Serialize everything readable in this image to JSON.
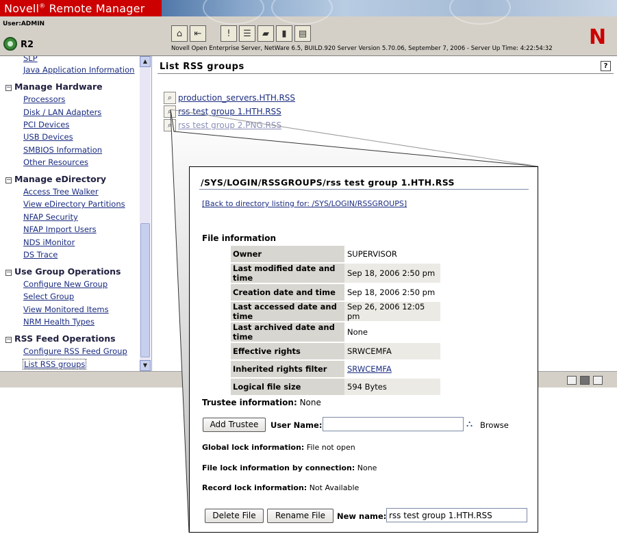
{
  "app": {
    "brand": "Novell",
    "brand_suffix": "Remote Manager",
    "user_label": "User:",
    "user_name": "ADMIN",
    "server_name": "R2",
    "server_info": "Novell Open Enterprise Server, NetWare 6.5, BUILD.920  Server Version 5.70.06, September 7, 2006 - Server Up Time: 4:22:54:32",
    "logo_letter": "N",
    "toolbar_icons": [
      "home-icon",
      "exit-icon",
      "health-alert-icon",
      "checklist-icon",
      "eraser-icon",
      "book-icon",
      "inbox-icon"
    ]
  },
  "sidebar": {
    "top_items": [
      "SLP",
      "Java Application Information"
    ],
    "groups": [
      {
        "title": "Manage Hardware",
        "items": [
          "Processors",
          "Disk / LAN Adapters",
          "PCI Devices",
          "USB Devices",
          "SMBIOS Information",
          "Other Resources"
        ]
      },
      {
        "title": "Manage eDirectory",
        "items": [
          "Access Tree Walker",
          "View eDirectory Partitions",
          "NFAP Security",
          "NFAP Import Users",
          "NDS iMonitor",
          "DS Trace"
        ]
      },
      {
        "title": "Use Group Operations",
        "items": [
          "Configure New Group",
          "Select Group",
          "View Monitored Items",
          "NRM Health Types"
        ]
      },
      {
        "title": "RSS Feed Operations",
        "items": [
          "Configure RSS Feed Group",
          "List RSS groups"
        ]
      }
    ],
    "selected": "List RSS groups"
  },
  "main": {
    "title": "List RSS groups",
    "help": "?",
    "rss_groups": [
      "production_servers.HTH.RSS",
      "rss test group 1.HTH.RSS",
      "rss test group 2.PNG.RSS"
    ]
  },
  "detail": {
    "path": "/SYS/LOGIN/RSSGROUPS/rss test group 1.HTH.RSS",
    "back_link": "[Back to directory listing for: /SYS/LOGIN/RSSGROUPS]",
    "file_info_title": "File information",
    "file_info": [
      {
        "label": "Owner",
        "value": "SUPERVISOR"
      },
      {
        "label": "Last modified date and time",
        "value": "Sep 18, 2006 2:50 pm"
      },
      {
        "label": "Creation date and time",
        "value": "Sep 18, 2006 2:50 pm"
      },
      {
        "label": "Last accessed date and time",
        "value": "Sep 26, 2006 12:05 pm"
      },
      {
        "label": "Last archived date and time",
        "value": "None"
      },
      {
        "label": "Effective rights",
        "value": "SRWCEMFA"
      },
      {
        "label": "Inherited rights filter",
        "value": "SRWCEMFA"
      },
      {
        "label": "Logical file size",
        "value": "594 Bytes"
      }
    ],
    "trustee_label": "Trustee information:",
    "trustee_value": "None",
    "add_trustee_button": "Add Trustee",
    "user_name_label": "User Name:",
    "user_name_value": "",
    "browse_label": "Browse",
    "global_lock_label": "Global lock information:",
    "global_lock_value": "File not open",
    "file_lock_label": "File lock information by connection:",
    "file_lock_value": "None",
    "record_lock_label": "Record lock information:",
    "record_lock_value": "Not Available",
    "delete_button": "Delete File",
    "rename_button": "Rename File",
    "new_name_label": "New name:",
    "new_name_value": "rss test group 1.HTH.RSS"
  },
  "colors": {
    "brand_red": "#cc0000",
    "link_blue": "#1a2c80",
    "chrome_gray": "#d4d0c8"
  }
}
